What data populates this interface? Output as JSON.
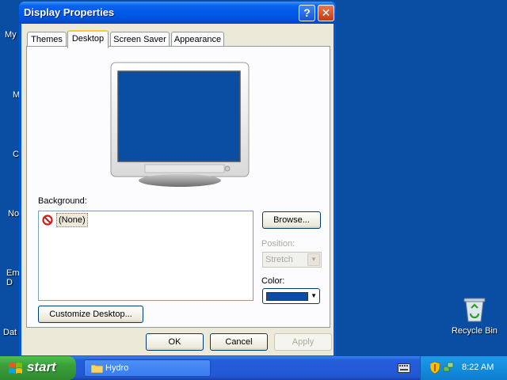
{
  "desktop": {
    "fragments": [
      "My",
      "M",
      "C",
      "No",
      "Em\nD",
      "Dat"
    ],
    "recycle_bin": "Recycle Bin"
  },
  "window": {
    "title": "Display Properties",
    "help_glyph": "?",
    "close_glyph": "✕",
    "tabs": [
      "Themes",
      "Desktop",
      "Screen Saver",
      "Appearance"
    ],
    "active_tab": "Desktop",
    "background_label": "Background:",
    "background_items": [
      "(None)"
    ],
    "browse_button": "Browse...",
    "position_label": "Position:",
    "position_value": "Stretch",
    "color_label": "Color:",
    "color_value": "#0a4ea3",
    "customize_button": "Customize Desktop...",
    "ok_button": "OK",
    "cancel_button": "Cancel",
    "apply_button": "Apply"
  },
  "taskbar": {
    "start_label": "start",
    "task": "Hydro",
    "clock": "8:22 AM"
  },
  "colors": {
    "desktop_bg": "#0a4ea3",
    "titlebar": "#0058e6",
    "start_green": "#3a9e3a",
    "tray_blue": "#138dde"
  },
  "icons": [
    "help-icon",
    "close-icon",
    "none-icon",
    "recycle-bin-icon",
    "windows-flag-icon",
    "folder-icon",
    "keyboard-icon",
    "security-shield-icon",
    "network-icon",
    "monitor-icon"
  ]
}
